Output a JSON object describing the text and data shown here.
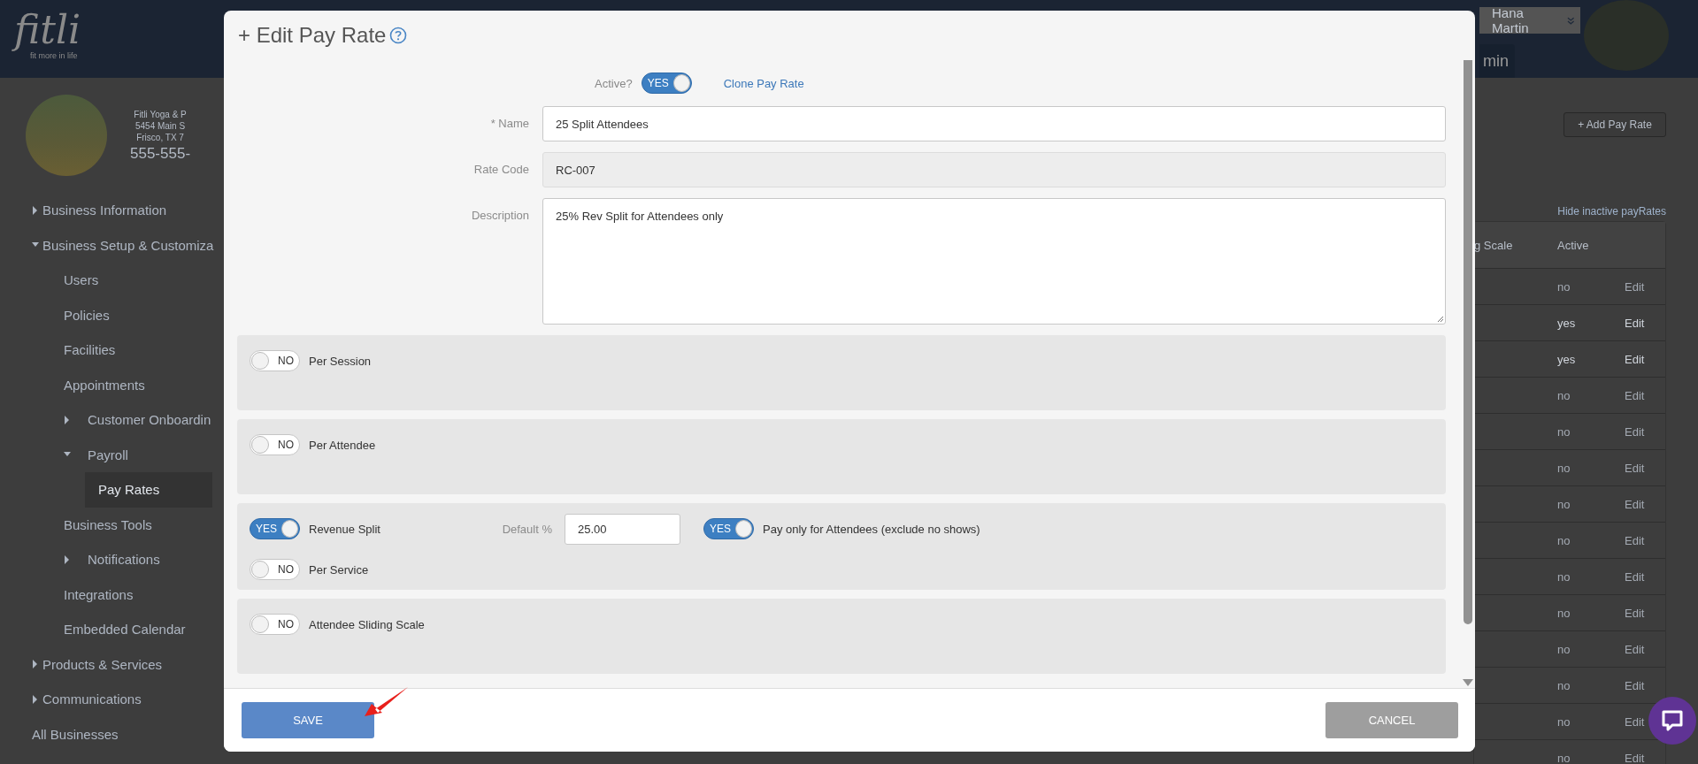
{
  "header": {
    "logo": "fitli",
    "tagline": "fit more in life",
    "user_name": "Hana Martin",
    "tab": "min"
  },
  "business": {
    "name": "Fitli Yoga & P",
    "address": "5454 Main S",
    "city": "Frisco, TX 7",
    "phone": "555-555-"
  },
  "sidebar": {
    "items": [
      {
        "label": "Business Information",
        "expanded": false,
        "selected": false
      },
      {
        "label": "Business Setup & Customiza",
        "expanded": true,
        "selected": false,
        "children": [
          {
            "label": "Users",
            "selected": false
          },
          {
            "label": "Policies",
            "selected": false
          },
          {
            "label": "Facilities",
            "selected": false
          },
          {
            "label": "Appointments",
            "selected": false
          },
          {
            "label": "Customer Onboardin",
            "expanded": false,
            "selected": false
          },
          {
            "label": "Payroll",
            "expanded": true,
            "selected": false,
            "children": [
              {
                "label": "Pay Rates",
                "selected": true
              }
            ]
          },
          {
            "label": "Business Tools",
            "selected": false
          },
          {
            "label": "Notifications",
            "expanded": false,
            "selected": false
          },
          {
            "label": "Integrations",
            "selected": false
          },
          {
            "label": "Embedded Calendar",
            "selected": false
          }
        ]
      },
      {
        "label": "Products & Services",
        "expanded": false,
        "selected": false
      },
      {
        "label": "Communications",
        "expanded": false,
        "selected": false
      },
      {
        "label": "All Businesses",
        "selected": false
      }
    ]
  },
  "toolbar": {
    "add_button": "+ Add Pay Rate",
    "hide_link": "Hide inactive payRates"
  },
  "table": {
    "columns": [
      "g Scale",
      "Active"
    ],
    "rows": [
      {
        "active": "no",
        "action": "Edit",
        "disabled": true
      },
      {
        "active": "yes",
        "action": "Edit",
        "disabled": false
      },
      {
        "active": "yes",
        "action": "Edit",
        "disabled": false
      },
      {
        "active": "no",
        "action": "Edit",
        "disabled": true
      },
      {
        "active": "no",
        "action": "Edit",
        "disabled": true
      },
      {
        "active": "no",
        "action": "Edit",
        "disabled": true
      },
      {
        "active": "no",
        "action": "Edit",
        "disabled": true
      },
      {
        "active": "no",
        "action": "Edit",
        "disabled": true
      },
      {
        "active": "no",
        "action": "Edit",
        "disabled": true
      },
      {
        "active": "no",
        "action": "Edit",
        "disabled": true
      },
      {
        "active": "no",
        "action": "Edit",
        "disabled": true
      },
      {
        "active": "no",
        "action": "Edit",
        "disabled": true
      },
      {
        "active": "no",
        "action": "Edit",
        "disabled": true
      },
      {
        "active": "no",
        "action": "Edit",
        "disabled": true
      }
    ]
  },
  "modal": {
    "title": "+ Edit Pay Rate",
    "active": {
      "label": "Active?",
      "on": true,
      "state": "YES"
    },
    "clone_link": "Clone Pay Rate",
    "fields": [
      {
        "kind": "input",
        "label": "* Name",
        "value": "25 Split Attendees"
      },
      {
        "kind": "readonly",
        "label": "Rate Code",
        "value": "RC-007"
      },
      {
        "kind": "textarea",
        "label": "Description",
        "value": "25% Rev Split for Attendees only"
      }
    ],
    "sections": [
      {
        "rows": [
          {
            "toggle": {
              "label": "Per Session",
              "on": false,
              "state": "NO"
            }
          }
        ]
      },
      {
        "rows": [
          {
            "toggle": {
              "label": "Per Attendee",
              "on": false,
              "state": "NO"
            }
          }
        ]
      },
      {
        "rows": [
          {
            "toggle": {
              "label": "Revenue Split",
              "on": true,
              "state": "YES"
            },
            "amount": {
              "label": "Default %",
              "value": "25.00"
            },
            "option": {
              "label": "Pay only for Attendees (exclude no shows)",
              "on": true,
              "state": "YES"
            }
          },
          {
            "toggle": {
              "label": "Per Service",
              "on": false,
              "state": "NO"
            }
          }
        ]
      },
      {
        "rows": [
          {
            "toggle": {
              "label": "Attendee Sliding Scale",
              "on": false,
              "state": "NO"
            }
          }
        ]
      }
    ],
    "save": "SAVE",
    "cancel": "CANCEL"
  }
}
